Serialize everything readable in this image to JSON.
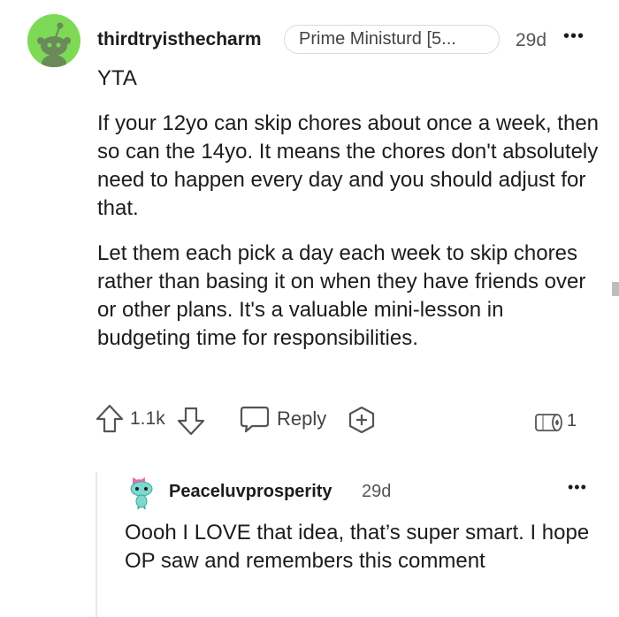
{
  "comment": {
    "username": "thirdtryisthecharm",
    "flair": "Prime Ministurd [5...",
    "time": "29d",
    "more": "•••",
    "verdict": "YTA",
    "paragraphs": [
      "If your 12yo can skip chores about once a week, then so can the 14yo. It means the chores don't absolutely need to happen every day and you should adjust for that.",
      "Let them each pick a day each week to skip chores rather than basing it on when they have friends over or other plans. It's a valuable mini-lesson in budgeting time for responsibilities."
    ],
    "actions": {
      "score": "1.1k",
      "reply_label": "Reply",
      "award_count": "1"
    }
  },
  "reply": {
    "username": "Peaceluvprosperity",
    "time": "29d",
    "more": "•••",
    "body": "Oooh I LOVE that idea, that’s super smart. I hope OP saw and remembers this comment"
  },
  "icons": {
    "avatar": "snoo-avatar-green",
    "upvote": "upvote-arrow-icon",
    "downvote": "downvote-arrow-icon",
    "reply": "speech-bubble-icon",
    "award": "add-award-icon",
    "award_badge": "toilet-paper-award-icon",
    "reply_avatar": "snoo-avatar-teal"
  },
  "colors": {
    "avatar_bg": "#7ed957",
    "text": "#1c1c1c",
    "meta": "#555555",
    "reply_avatar": "#7fd8cf"
  }
}
